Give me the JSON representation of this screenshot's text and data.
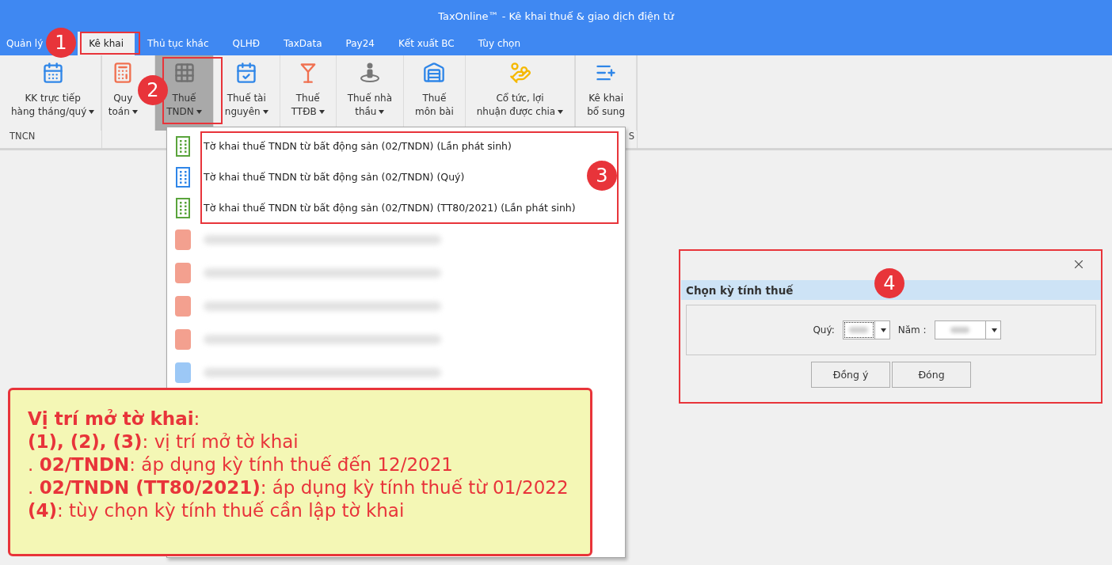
{
  "window": {
    "title": "TaxOnline™ - Kê khai thuế & giao dịch điện tử"
  },
  "tabs": [
    {
      "label": "Quản lý",
      "selected": false
    },
    {
      "label": "Kê khai",
      "selected": true
    },
    {
      "label": "Thủ tục khác",
      "selected": false
    },
    {
      "label": "QLHĐ",
      "selected": false
    },
    {
      "label": "TaxData",
      "selected": false
    },
    {
      "label": "Pay24",
      "selected": false
    },
    {
      "label": "Kết xuất BC",
      "selected": false
    },
    {
      "label": "Tùy chọn",
      "selected": false
    }
  ],
  "ribbon": {
    "groups": [
      {
        "label": "TNCN",
        "buttons": [
          {
            "lines": [
              "KK trực tiếp",
              "hàng tháng/quý"
            ],
            "dropdown": true,
            "pressed": false
          }
        ]
      },
      {
        "buttons": [
          {
            "lines": [
              "Quy",
              "toán"
            ],
            "dropdown": true,
            "pressed": false
          },
          {
            "lines": [
              "Thuế",
              "TNDN"
            ],
            "dropdown": true,
            "pressed": true
          },
          {
            "lines": [
              "Thuế tài",
              "nguyên"
            ],
            "dropdown": true,
            "pressed": false
          },
          {
            "lines": [
              "Thuế",
              "TTĐB"
            ],
            "dropdown": true,
            "pressed": false
          },
          {
            "lines": [
              "Thuế nhà",
              "thầu"
            ],
            "dropdown": true,
            "pressed": false
          },
          {
            "lines": [
              "Thuế",
              "môn bài"
            ],
            "dropdown": false,
            "pressed": false
          },
          {
            "lines": [
              "Cổ tức, lợi",
              "nhuận được chia"
            ],
            "dropdown": true,
            "pressed": false
          }
        ]
      },
      {
        "label": "S",
        "buttons": [
          {
            "lines": [
              "Kê khai",
              "bổ sung"
            ],
            "dropdown": false,
            "pressed": false
          }
        ]
      }
    ]
  },
  "menu": {
    "items": [
      {
        "kind": "item",
        "label": "Tờ khai thuế TNDN từ bất động sản (02/TNDN) (Lần phát sinh)",
        "color": "#5aa43c"
      },
      {
        "kind": "item",
        "label": "Tờ khai thuế TNDN từ bất động sản (02/TNDN) (Quý)",
        "color": "#2f86e8"
      },
      {
        "kind": "item",
        "label": "Tờ khai thuế TNDN từ bất động sản (02/TNDN) (TT80/2021) (Lần phát sinh)",
        "color": "#5aa43c"
      },
      {
        "kind": "blurred",
        "color": "#f3a08f"
      },
      {
        "kind": "blurred",
        "color": "#f3a08f"
      },
      {
        "kind": "blurred",
        "color": "#f3a08f"
      },
      {
        "kind": "blurred",
        "color": "#f3a08f"
      },
      {
        "kind": "blurred",
        "color": "#9cc8f6"
      }
    ]
  },
  "dialog": {
    "heading": "Chọn kỳ tính thuế",
    "quarter_label": "Quý:",
    "year_label": "Năm :",
    "buttons": [
      "Đồng ý",
      "Đóng"
    ]
  },
  "markers": [
    "1",
    "2",
    "3",
    "4"
  ],
  "note": {
    "lines": [
      "**Vị trí mở tờ khai**:",
      "**(1), (2), (3)**: vị trí mở tờ khai",
      ". **02/TNDN**: áp dụng kỳ tính thuế đến 12/2021",
      ". **02/TNDN (TT80/2021)**: áp dụng kỳ tính thuế từ 01/2022",
      "**(4)**: tùy chọn kỳ tính thuế cần lập tờ khai"
    ]
  }
}
